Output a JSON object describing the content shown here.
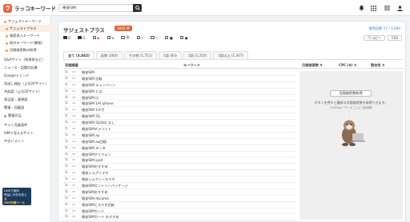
{
  "header": {
    "logo_text": "ラッコキーワード",
    "logo_mark": "ラ",
    "search_value": "格安SIM"
  },
  "sidebar": {
    "items": [
      {
        "label": "サジェストキーワード",
        "active": false,
        "sub": false
      },
      {
        "label": "サジェストプラス",
        "active": true,
        "sub": true
      },
      {
        "label": "検索流入キーワード",
        "active": false,
        "sub": true
      },
      {
        "label": "他のキーワード(類推)",
        "active": false,
        "sub": true
      },
      {
        "label": "月間検索数の取得",
        "active": false,
        "sub": true
      },
      {
        "label": "Q&Aサイト（知恵袋など）",
        "active": false,
        "sub": false
      },
      {
        "label": "ニュース・話題の記事",
        "active": false,
        "sub": false
      },
      {
        "label": "Googleトレンド",
        "active": false,
        "sub": false
      },
      {
        "label": "見出し抽出（上位20サイト）",
        "active": false,
        "sub": false
      },
      {
        "label": "共起語（上位20サイト）",
        "active": false,
        "sub": false
      },
      {
        "label": "周辺語・連想語",
        "active": false,
        "sub": false
      },
      {
        "label": "関連・同義語",
        "active": false,
        "sub": false
      },
      {
        "label": "関連作品",
        "active": false,
        "sub": false
      },
      {
        "label": "サイト売買案件",
        "active": false,
        "sub": false
      },
      {
        "label": "SIMで見えるサイト",
        "active": false,
        "sub": false
      },
      {
        "label": "中古ドメイン",
        "active": false,
        "sub": false
      }
    ],
    "ad": {
      "line1": "LINEで無料",
      "line2": "有益に分析を変える",
      "line3": "SEO対策ツール"
    }
  },
  "main": {
    "title": "サジェストプラス",
    "badge": "3842 件",
    "usage": "使用回数 17 / 3,000",
    "filters": [
      {
        "label": "G",
        "checked": true
      },
      {
        "label": "G",
        "checked": true
      },
      {
        "label": "▶",
        "checked": false
      },
      {
        "label": "a",
        "checked": false
      },
      {
        "label": "楽",
        "checked": false
      },
      {
        "label": "♪",
        "checked": false
      },
      {
        "label": "S",
        "checked": false
      },
      {
        "label": "■",
        "checked": false
      },
      {
        "label": "●",
        "checked": false
      }
    ],
    "copy_label": "コピー",
    "csv_label": "CSV",
    "tabs": [
      {
        "label": "全て (3,842)",
        "active": true
      },
      {
        "label": "英数 (260)",
        "active": false
      },
      {
        "label": "その他 (1,751)",
        "active": false
      },
      {
        "label": "1語 (83)",
        "active": false
      },
      {
        "label": "3語 (1,250)",
        "active": false
      },
      {
        "label": "3語以上 (1,307)",
        "active": false
      }
    ],
    "headers": {
      "ops": "深掘順番",
      "keyword": "キーワード",
      "volume": "月間検索数",
      "cpc": "CPC ($)",
      "competition": "競合性"
    },
    "keywords": [
      "格安SIM",
      "格安SIM 比較",
      "格安SIM キャンペーン",
      "格安SIM とは",
      "格安SIM iij",
      "格安SIM 1円 iphone",
      "格安SIM 1ギガ",
      "格安SIM 5G",
      "格安SIM 5G対応 なし",
      "格安SIMデメリット",
      "格安SIM au",
      "格安SIM au回線",
      "格安SIM データ",
      "格安SIMアイフォン",
      "格安SIM ipad",
      "格安SIMおすすめ",
      "格安シムプリマホ",
      "格安シムフリースマホ",
      "格安SIMエントリーパッケージ",
      "格安SIMおすすめ",
      "格安SIM docomo",
      "格安SIMとスマホ比較",
      "格安SIMカード",
      "格安SIMカード おすすめ"
    ],
    "fetch_button": "月間検索数取得",
    "note1": "ボタンを押すと最新の月間検索数を取得できます。",
    "note2": "4,500キーワードごとに1回消費"
  },
  "colors": {
    "accent": "#e8643a",
    "active_bg": "#fdeee5",
    "link": "#2f7fd6"
  }
}
